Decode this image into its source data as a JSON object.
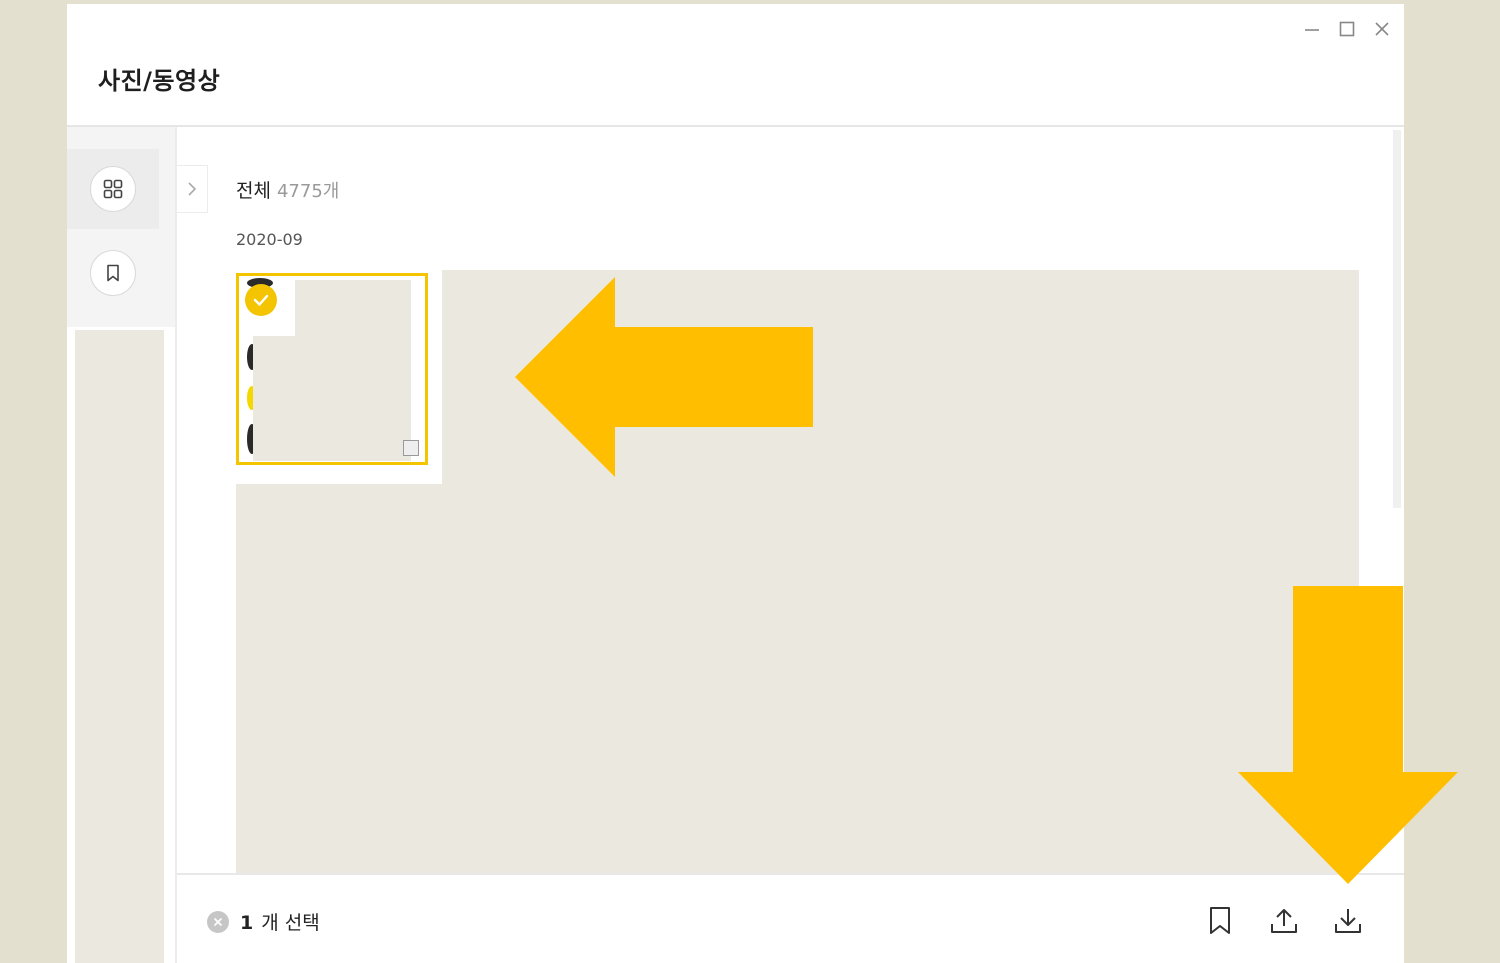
{
  "window": {
    "title": "사진/동영상",
    "controls": [
      "minimize-icon",
      "maximize-icon",
      "close-icon"
    ]
  },
  "sidebar": {
    "items": [
      {
        "icon": "grid-icon",
        "active": true
      },
      {
        "icon": "bookmark-icon",
        "active": false
      }
    ],
    "collapse_icon": "chevron-right-icon"
  },
  "main": {
    "heading": "전체",
    "count": "4775개",
    "date_group": "2020-09",
    "selected_thumbnail": {
      "selected": true
    }
  },
  "bottom_bar": {
    "selected_count": "1",
    "selected_label": "개 선택",
    "actions": [
      "bookmark-icon",
      "share-icon",
      "download-icon"
    ]
  },
  "colors": {
    "accent": "#f5c400",
    "annotation_arrow": "#ffbe00",
    "redaction": "#ebe9df",
    "outer_background": "#e3e0cf"
  }
}
